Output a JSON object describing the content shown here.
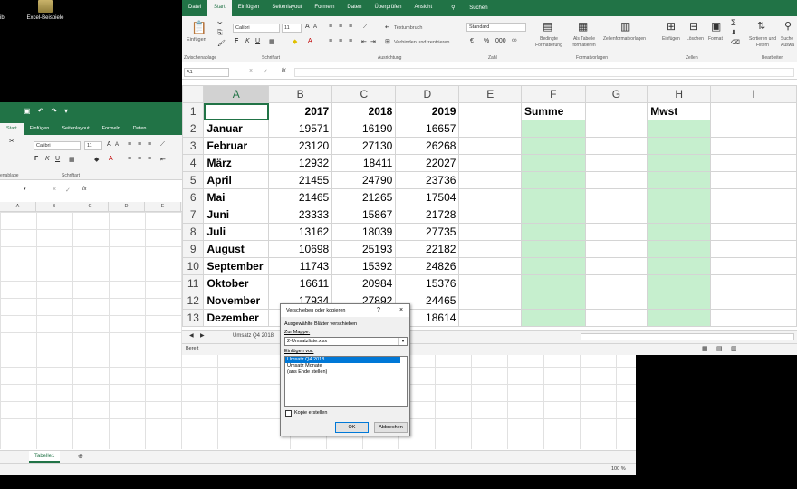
{
  "desktop": {
    "icons": [
      {
        "label": "Excel-Beispiele"
      }
    ],
    "partial_label": "ib"
  },
  "back_window": {
    "tabs": [
      "Start",
      "Einfügen",
      "Seitenlayout",
      "Formeln",
      "Daten"
    ],
    "active_tab": "Start",
    "font": "Calibri",
    "size": "11",
    "groups": [
      "enablage",
      "Schriftart"
    ],
    "columns": [
      "A",
      "B",
      "C",
      "D",
      "E"
    ],
    "sheet_tab": "Tabelle1",
    "zoom": "100 %"
  },
  "front_window": {
    "tabs": [
      "Datei",
      "Start",
      "Einfügen",
      "Seitenlayout",
      "Formeln",
      "Daten",
      "Überprüfen",
      "Ansicht",
      "Suchen"
    ],
    "active_tab": "Start",
    "ribbon": {
      "paste": "Einfügen",
      "font": "Calibri",
      "size": "11",
      "wrap": "Textumbruch",
      "merge": "Verbinden und zentrieren",
      "number_format": "Standard",
      "cond_format": [
        "Bedingte",
        "Formatierung"
      ],
      "as_table": [
        "Als Tabelle",
        "formatieren"
      ],
      "cell_styles": "Zellenformatvorlagen",
      "insert": "Einfügen",
      "delete": "Löschen",
      "format": "Format",
      "sort": [
        "Sortieren und",
        "Filtern"
      ],
      "search": [
        "Suche",
        "Auswä"
      ],
      "groups": [
        "Zwischenablage",
        "Schriftart",
        "Ausrichtung",
        "Zahl",
        "Formatvorlagen",
        "Zellen",
        "Bearbeiten"
      ]
    },
    "namebox": "A1",
    "fx": "fx",
    "columns": [
      "A",
      "B",
      "C",
      "D",
      "E",
      "F",
      "G",
      "H",
      "I"
    ],
    "header_row": {
      "b": "2017",
      "c": "2018",
      "d": "2019",
      "f": "Summe",
      "h": "Mwst"
    },
    "rows": [
      {
        "n": "2",
        "m": "Januar",
        "a": "19571",
        "b": "16190",
        "c": "16657"
      },
      {
        "n": "3",
        "m": "Februar",
        "a": "23120",
        "b": "27130",
        "c": "26268"
      },
      {
        "n": "4",
        "m": "März",
        "a": "12932",
        "b": "18411",
        "c": "22027"
      },
      {
        "n": "5",
        "m": "April",
        "a": "21455",
        "b": "24790",
        "c": "23736"
      },
      {
        "n": "6",
        "m": "Mai",
        "a": "21465",
        "b": "21265",
        "c": "17504"
      },
      {
        "n": "7",
        "m": "Juni",
        "a": "23333",
        "b": "15867",
        "c": "21728"
      },
      {
        "n": "8",
        "m": "Juli",
        "a": "13162",
        "b": "18039",
        "c": "27735"
      },
      {
        "n": "9",
        "m": "August",
        "a": "10698",
        "b": "25193",
        "c": "22182"
      },
      {
        "n": "10",
        "m": "September",
        "a": "11743",
        "b": "15392",
        "c": "24826"
      },
      {
        "n": "11",
        "m": "Oktober",
        "a": "16611",
        "b": "20984",
        "c": "15376"
      },
      {
        "n": "12",
        "m": "November",
        "a": "17934",
        "b": "27892",
        "c": "24465"
      },
      {
        "n": "13",
        "m": "Dezember",
        "a": "",
        "b": "",
        "c": "18614"
      }
    ],
    "sheet_tab": "Umsatz Q4 2018",
    "status": "Bereit",
    "green": "#c6efce"
  },
  "dialog": {
    "title": "Verschieben oder kopieren",
    "help": "?",
    "close": "×",
    "move_label": "Ausgewählte Blätter verschieben",
    "to_book_label": "Zur Mappe:",
    "book": "2-Umsatzliste.xlsx",
    "insert_before_label": "Einfügen vor:",
    "items": [
      "Umsatz Q4 2018",
      "Umsatz Monate",
      "(ans Ende stellen)"
    ],
    "copy_label": "Kopie erstellen",
    "ok": "OK",
    "cancel": "Abbrechen"
  },
  "colors": {
    "excel_green": "#217346",
    "cell_green": "#c6efce",
    "selection": "#0078d7"
  }
}
